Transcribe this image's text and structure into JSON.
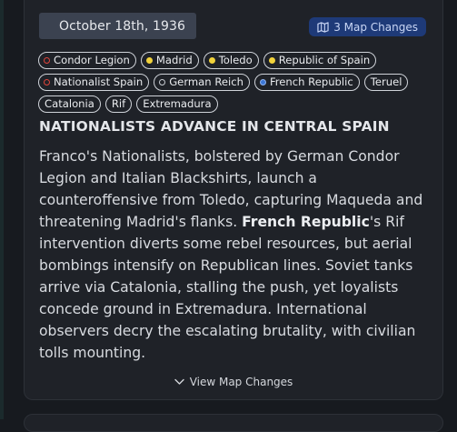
{
  "event": {
    "date": "October 18th, 1936",
    "map_changes_label": "3 Map Changes",
    "tags": [
      {
        "label": "Condor Legion",
        "marker": "red-ring"
      },
      {
        "label": "Madrid",
        "marker": "yellow-dot"
      },
      {
        "label": "Toledo",
        "marker": "yellow-dot"
      },
      {
        "label": "Republic of Spain",
        "marker": "yellow-dot"
      },
      {
        "label": "Nationalist Spain",
        "marker": "red-ring"
      },
      {
        "label": "German Reich",
        "marker": "grey-ring"
      },
      {
        "label": "French Republic",
        "marker": "blue-dot"
      },
      {
        "label": "Teruel",
        "marker": "none"
      },
      {
        "label": "Catalonia",
        "marker": "none"
      },
      {
        "label": "Rif",
        "marker": "none"
      },
      {
        "label": "Extremadura",
        "marker": "none"
      }
    ],
    "headline": "NATIONALISTS ADVANCE IN CENTRAL SPAIN",
    "body_before": "Franco's Nationalists, bolstered by German Condor Legion and Italian Blackshirts, launch a counteroffensive from Toledo, capturing Maqueda and threatening Madrid's flanks. ",
    "body_highlight": "French Republic",
    "body_after": "'s Rif intervention diverts some rebel resources, but aerial bombings intensify on Republican lines. Soviet tanks arrive via Catalonia, stalling the push, yet loyalists concede ground in Extremadura. International observers decry the escalating brutality, with civilian tolls mounting.",
    "view_changes_label": "View Map Changes"
  },
  "colors": {
    "background": "#171a1f",
    "card": "#1f2228",
    "date_pill": "#3b4250",
    "badge": "#1e3a78",
    "red": "#e0443b",
    "yellow": "#f1d23b",
    "blue": "#3c77d6"
  },
  "icons": [
    "calendar-icon",
    "map-icon",
    "chevron-down-icon"
  ]
}
